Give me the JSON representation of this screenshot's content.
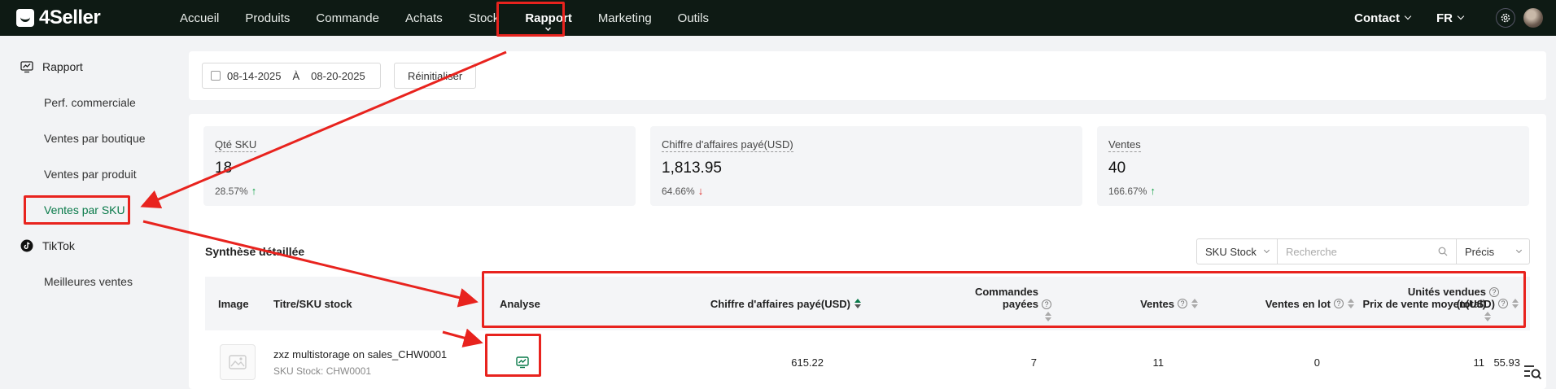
{
  "brand": {
    "name": "4Seller"
  },
  "nav": {
    "items": [
      "Accueil",
      "Produits",
      "Commande",
      "Achats",
      "Stock",
      "Rapport",
      "Marketing",
      "Outils"
    ],
    "active": "Rapport",
    "contact": "Contact",
    "language": "FR"
  },
  "sidebar": {
    "group_report": "Rapport",
    "report_items": [
      "Perf. commerciale",
      "Ventes par boutique",
      "Ventes par produit",
      "Ventes par SKU"
    ],
    "active_item": "Ventes par SKU",
    "group_tiktok": "TikTok",
    "tiktok_items": [
      "Meilleures ventes"
    ]
  },
  "filters": {
    "date_start": "08-14-2025",
    "date_separator": "À",
    "date_end": "08-20-2025",
    "reset_label": "Réinitialiser"
  },
  "cards": [
    {
      "title": "Qté SKU",
      "value": "18",
      "change": "28.57%",
      "direction": "up"
    },
    {
      "title": "Chiffre d'affaires payé(USD)",
      "value": "1,813.95",
      "change": "64.66%",
      "direction": "down"
    },
    {
      "title": "Ventes",
      "value": "40",
      "change": "166.67%",
      "direction": "up"
    }
  ],
  "table": {
    "section_title": "Synthèse détaillée",
    "search_field": "SKU Stock",
    "search_placeholder": "Recherche",
    "match_mode": "Précis",
    "columns": {
      "image": "Image",
      "title": "Titre/SKU stock",
      "analysis": "Analyse",
      "revenue": "Chiffre d'affaires payé(USD)",
      "orders_line1": "Commandes",
      "orders_line2": "payées",
      "sales": "Ventes",
      "bundle_sales": "Ventes en lot",
      "units_line1": "Unités vendues",
      "units_line2": "(total)",
      "avg_price": "Prix de vente moyen(USD)"
    },
    "rows": [
      {
        "title": "zxz multistorage on sales_CHW0001",
        "sku_label": "SKU Stock: CHW0001",
        "revenue": "615.22",
        "orders": "7",
        "sales": "11",
        "bundle_sales": "0",
        "units": "11",
        "avg_price": "55.93"
      }
    ]
  },
  "colors": {
    "topbar": "#0e1a14",
    "accent": "#0a7a4a",
    "annotation": "#e8231e"
  }
}
